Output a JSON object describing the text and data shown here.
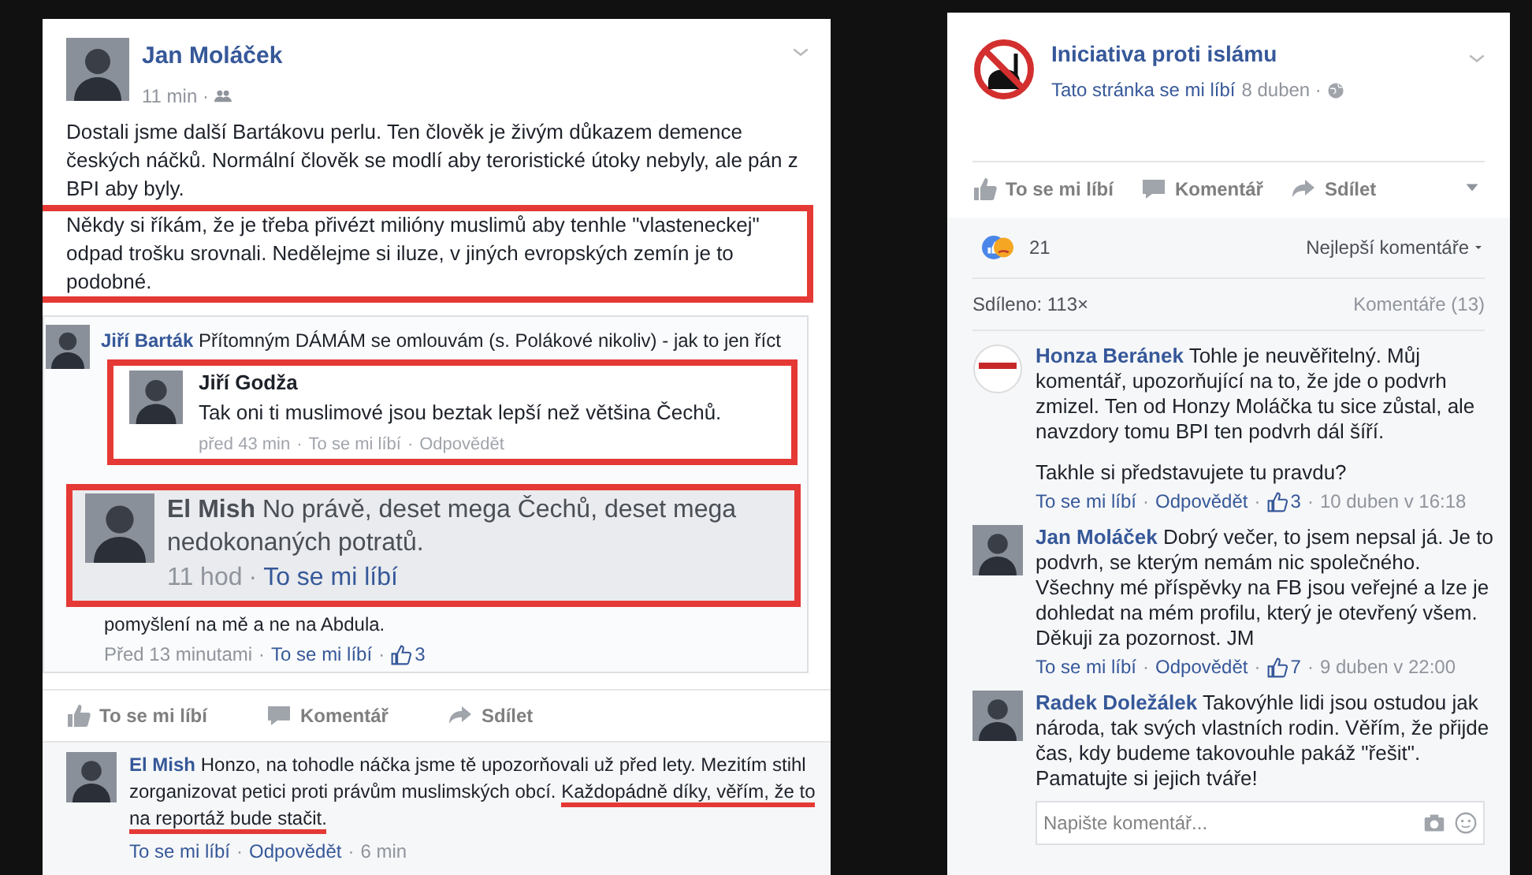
{
  "separator": "·",
  "left_post": {
    "author": "Jan Moláček",
    "time": "11 min ·",
    "paragraph": "Dostali jsme další Bartákovu perlu. Ten člověk je živým důkazem demence českých náčků. Normální člověk se modlí aby teroristické útoky nebyly, ale pán z BPI aby byly.",
    "highlighted_paragraph": "Někdy si říkám, že je třeba přivézt milióny muslimů aby tenhle \"vlasteneckej\" odpad trošku srovnali. Nedělejme si iluze, v jiných evropských zemín je to podobné.",
    "thread": {
      "author": "Jiří Barták",
      "first_line": "Přítomným DÁMÁM se omlouvám (s. Polákové nikoliv) - jak to jen říct",
      "last_line": "pomyšlení na mě a ne na Abdula.",
      "meta": [
        {
          "kind": "time",
          "text": "Před 13 minutami"
        },
        {
          "kind": "link",
          "text": "To se mi líbí"
        },
        {
          "kind": "likes",
          "text": "3"
        }
      ]
    },
    "callouts": [
      {
        "kind": "reply",
        "author": "Jiří Godža",
        "text": "Tak oni ti muslimové jsou beztak lepší než většina Čechů.",
        "meta": [
          {
            "kind": "time",
            "text": "před 43 min"
          },
          {
            "kind": "time",
            "text": "To se mi líbí"
          },
          {
            "kind": "time",
            "text": "Odpovědět"
          }
        ]
      },
      {
        "kind": "large",
        "author": "El Mish",
        "text": "No právě, deset mega Čechů, deset mega nedokonaných potratů.",
        "meta": [
          {
            "kind": "time",
            "text": "11 hod"
          },
          {
            "kind": "link",
            "text": "To se mi líbí"
          }
        ]
      }
    ],
    "actions": [
      {
        "label": "To se mi líbí"
      },
      {
        "label": "Komentář"
      },
      {
        "label": "Sdílet"
      }
    ],
    "comment": {
      "author": "El Mish",
      "parts": [
        {
          "text": "Honzo, na tohodle náčka jsme tě upozorňovali už před lety. Mezitím stihl zorganizovat petici proti právům muslimských obcí. ",
          "underlined": false
        },
        {
          "text": "Každopádně díky, věřím, že to na reportáž bude stačit.",
          "underlined": true
        }
      ],
      "meta": [
        {
          "kind": "link",
          "text": "To se mi líbí"
        },
        {
          "kind": "link",
          "text": "Odpovědět"
        },
        {
          "kind": "time",
          "text": "6 min"
        }
      ]
    }
  },
  "right_post": {
    "page": "Iniciativa proti islámu",
    "liked": "Tato stránka se mi líbí",
    "date": "8 duben ·",
    "actions": [
      {
        "label": "To se mi líbí"
      },
      {
        "label": "Komentář"
      },
      {
        "label": "Sdílet"
      }
    ],
    "reaction_count": "21",
    "sort": "Nejlepší komentáře",
    "shares": "Sdíleno: 113×",
    "comments_count": "Komentáře (13)",
    "comments": [
      {
        "author": "Honza Beránek",
        "paragraphs": [
          "Tohle je neuvěřitelný. Můj komentář, upozorňující na to, že jde o podvrh zmizel. Ten od Honzy Moláčka tu sice zůstal, ale navzdory tomu BPI ten podvrh dál šíří.",
          "Takhle si představujete tu pravdu?"
        ],
        "meta": [
          {
            "kind": "link",
            "text": "To se mi líbí"
          },
          {
            "kind": "link",
            "text": "Odpovědět"
          },
          {
            "kind": "likes",
            "text": "3"
          },
          {
            "kind": "time",
            "text": "10 duben v 16:18"
          }
        ]
      },
      {
        "author": "Jan Moláček",
        "paragraphs": [
          "Dobrý večer, to jsem nepsal já. Je to podvrh, se kterým nemám nic společného. Všechny mé příspěvky na FB jsou veřejné a lze je dohledat na mém profilu, který je otevřený všem. Děkuji za pozornost. JM"
        ],
        "meta": [
          {
            "kind": "link",
            "text": "To se mi líbí"
          },
          {
            "kind": "link",
            "text": "Odpovědět"
          },
          {
            "kind": "likes",
            "text": "7"
          },
          {
            "kind": "time",
            "text": "9 duben v 22:00"
          }
        ]
      },
      {
        "author": "Radek Doležálek",
        "paragraphs": [
          "Takovýhle lidi jsou ostudou jak národa, tak svých vlastních rodin. Věřím, že přijde čas, kdy budeme takovouhle pakáž \"řešit\". Pamatujte si jejich tváře!"
        ]
      }
    ],
    "comment_box": {
      "placeholder": "Napište komentář..."
    }
  }
}
